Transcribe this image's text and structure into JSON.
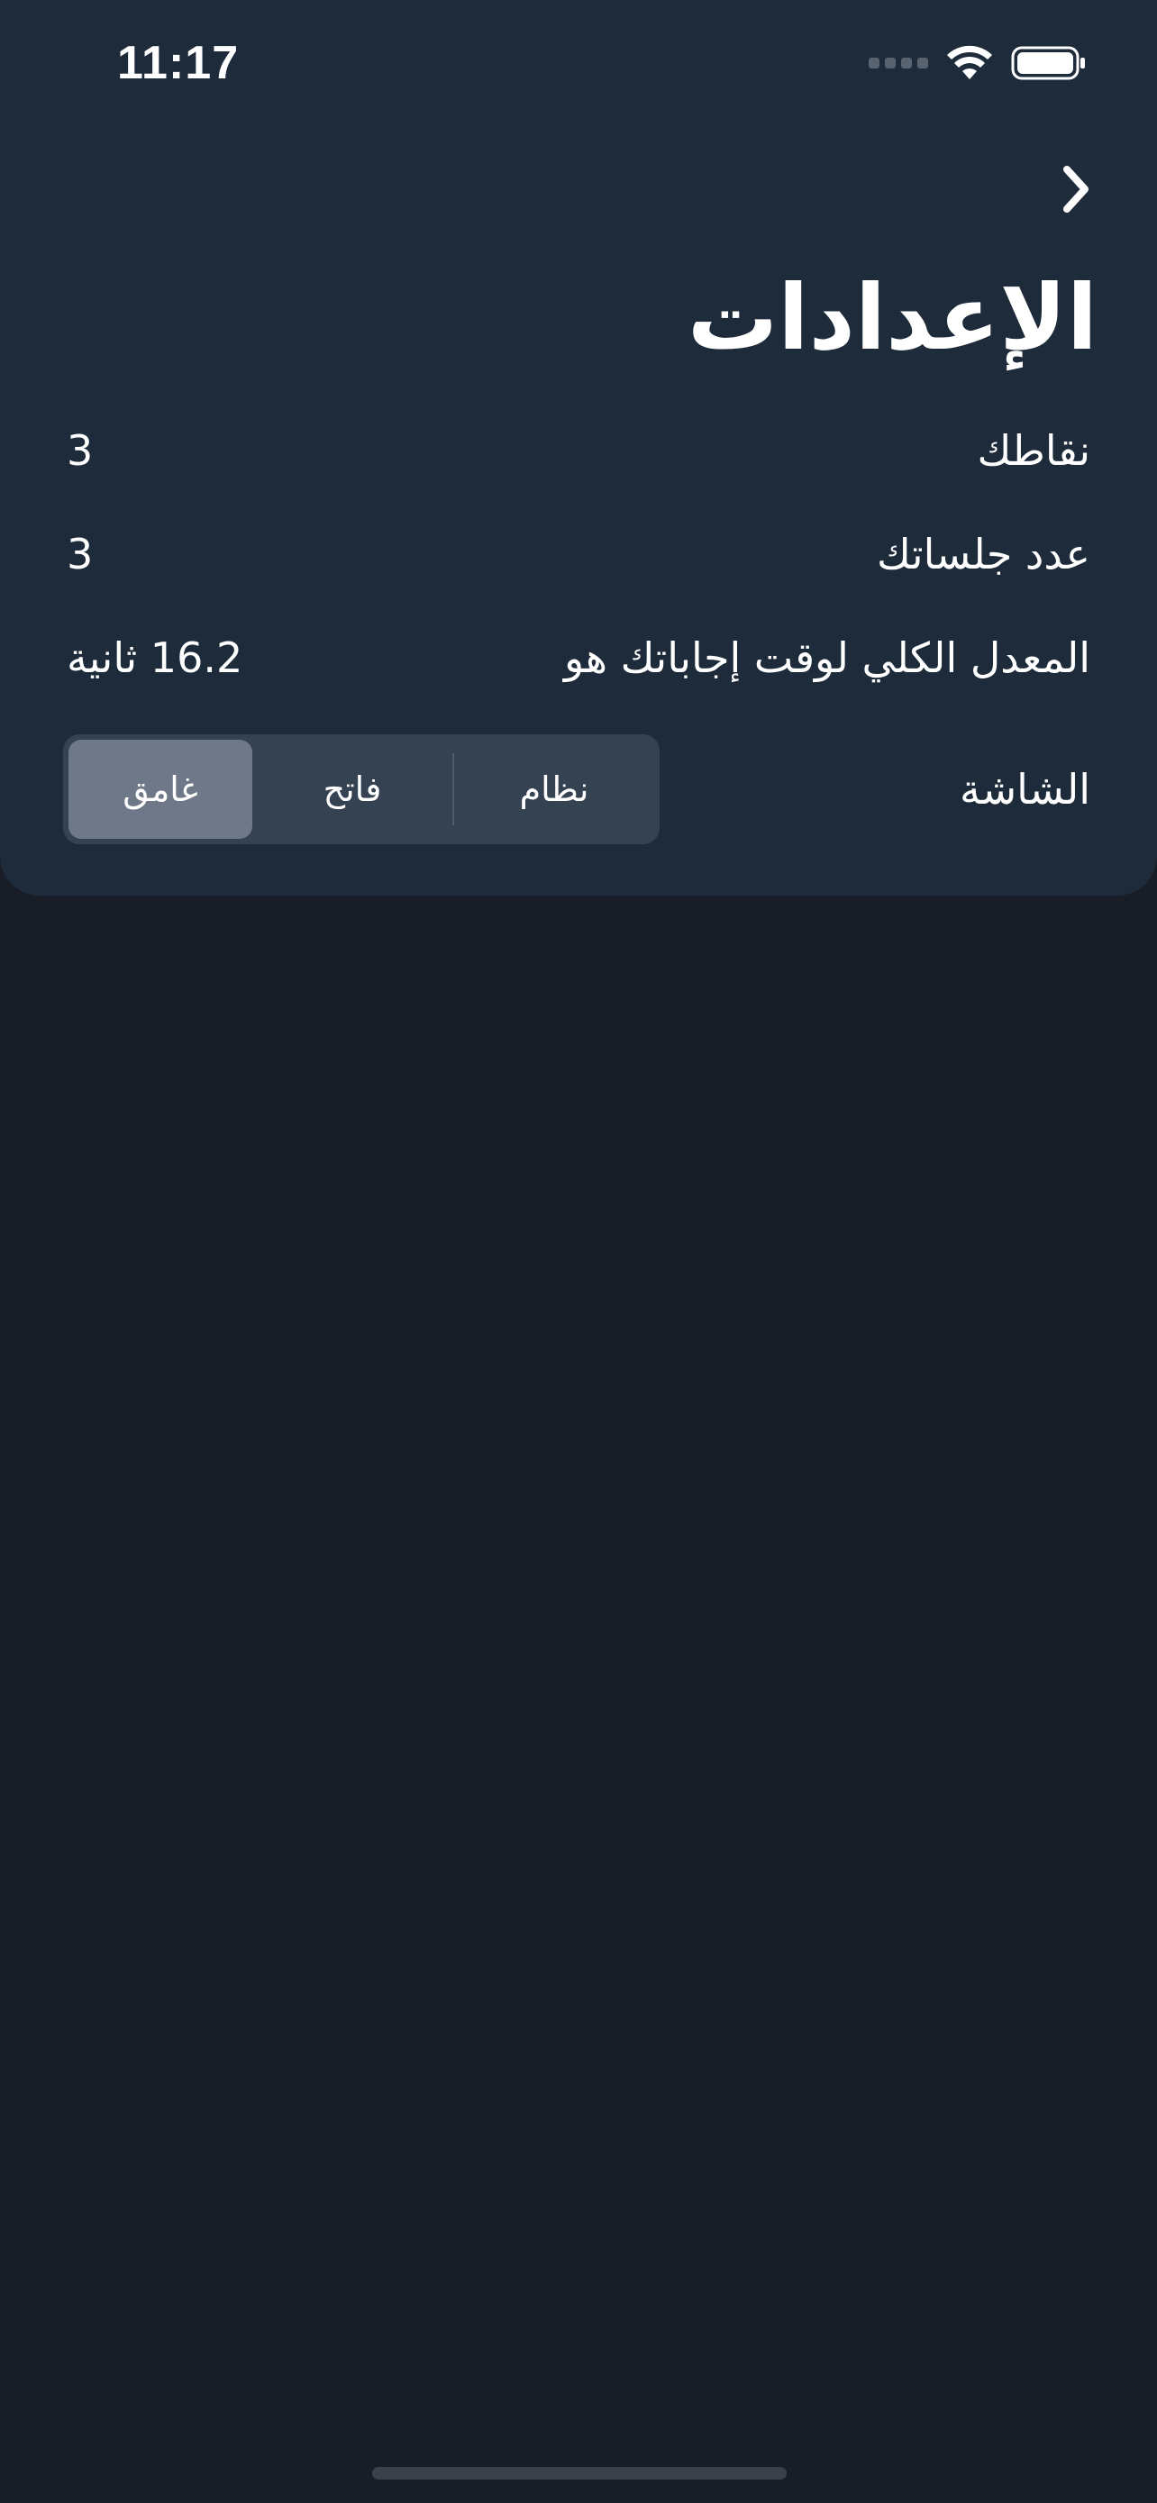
{
  "status_bar": {
    "time": "11:17"
  },
  "header": {
    "back_icon": "chevron-right-icon",
    "title": "الإعدادات"
  },
  "stats": [
    {
      "label": "نقاطك",
      "value": "3"
    },
    {
      "label": "عدد جلساتك",
      "value": "3"
    },
    {
      "label": "المعدل الكلي لوقت إجاباتك هو",
      "value": "16.2 ثانية"
    }
  ],
  "theme": {
    "label": "الشاشة",
    "options": [
      "غامق",
      "فاتح",
      "نظام"
    ],
    "selected": "غامق"
  },
  "colors": {
    "background": "#181d28",
    "card": "#1e2b3a",
    "segment_track": "#344252",
    "segment_selected": "#6e7889"
  }
}
